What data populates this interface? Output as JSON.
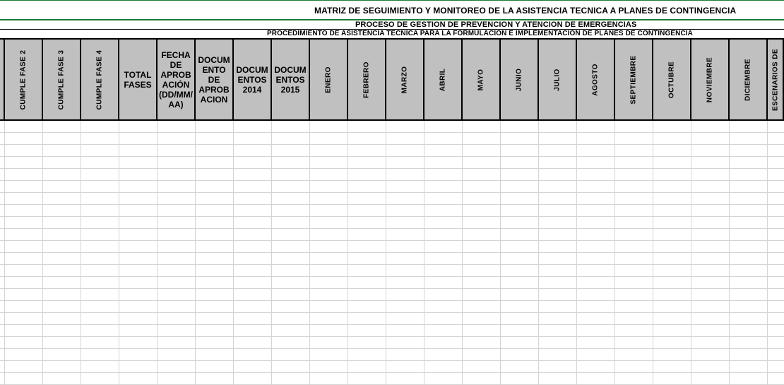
{
  "titles": {
    "matrix": "MATRIZ DE SEGUIMIENTO Y MONITOREO DE LA ASISTENCIA TECNICA A PLANES DE CONTINGENCIA",
    "process": "PROCESO DE GESTION DE PREVENCION Y ATENCION DE EMERGENCIAS",
    "procedure": "PROCEDIMIENTO DE ASISTENCIA TECNICA PARA LA FORMULACION E IMPLEMENTACION DE PLANES DE CONTINGENCIA"
  },
  "columns": [
    {
      "label": "CUMPLE FASE 2",
      "vertical": true
    },
    {
      "label": "CUMPLE FASE 3",
      "vertical": true
    },
    {
      "label": "CUMPLE FASE 4",
      "vertical": true
    },
    {
      "label": "TOTAL FASES",
      "vertical": false
    },
    {
      "label": "FECHA DE APROB ACIÓN (DD/MM/ AA)",
      "vertical": false
    },
    {
      "label": "DOCUM ENTO DE APROB ACION",
      "vertical": false
    },
    {
      "label": "DOCUM ENTOS 2014",
      "vertical": false
    },
    {
      "label": "DOCUM ENTOS 2015",
      "vertical": false
    },
    {
      "label": "ENERO",
      "vertical": true
    },
    {
      "label": "FEBRERO",
      "vertical": true
    },
    {
      "label": "MARZO",
      "vertical": true
    },
    {
      "label": "ABRIL",
      "vertical": true
    },
    {
      "label": "MAYO",
      "vertical": true
    },
    {
      "label": "JUNIO",
      "vertical": true
    },
    {
      "label": "JULIO",
      "vertical": true
    },
    {
      "label": "AGOSTO",
      "vertical": true
    },
    {
      "label": "SEPTIEMBRE",
      "vertical": true
    },
    {
      "label": "OCTUBRE",
      "vertical": true
    },
    {
      "label": "NOVIEMBRE",
      "vertical": true
    },
    {
      "label": "DICIEMBRE",
      "vertical": true
    },
    {
      "label": "ESCENARIOS DE",
      "vertical": true
    }
  ],
  "colors": {
    "header_fill": "#c0c0c0",
    "title_rule": "#1f7a3a",
    "gridline": "#d4d4d4"
  }
}
